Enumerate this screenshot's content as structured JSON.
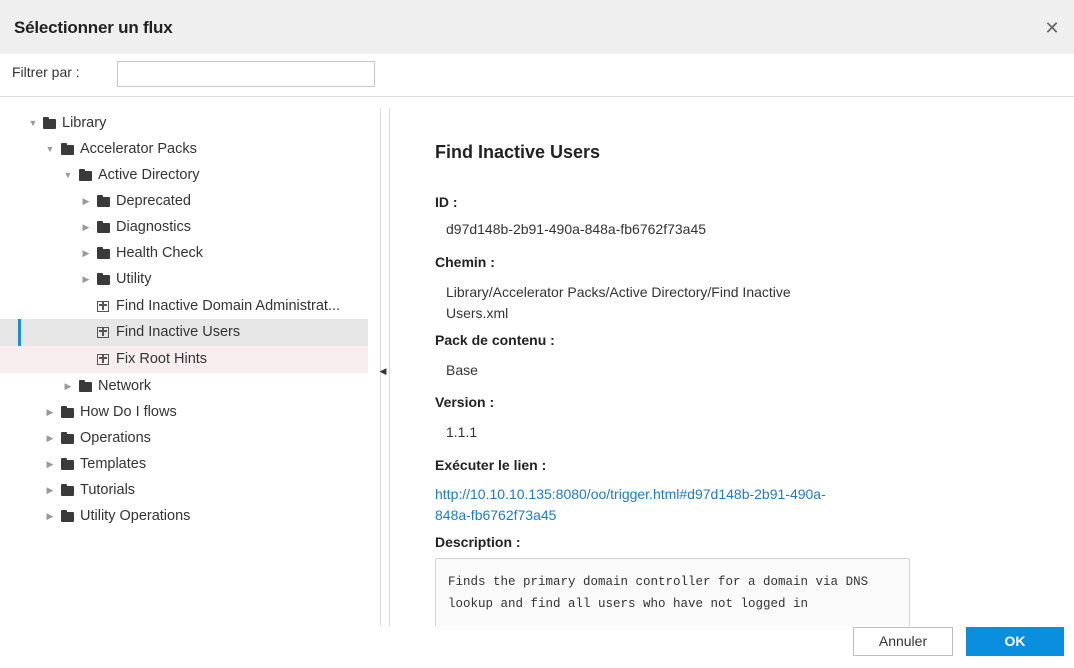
{
  "dialog": {
    "title": "Sélectionner un flux",
    "close_icon": "close-icon"
  },
  "filter": {
    "label": "Filtrer par :",
    "value": ""
  },
  "tree": {
    "nodes": [
      {
        "label": "Library",
        "type": "folder",
        "expanded": true
      },
      {
        "label": "Accelerator Packs",
        "type": "folder",
        "expanded": true
      },
      {
        "label": "Active Directory",
        "type": "folder",
        "expanded": true
      },
      {
        "label": "Deprecated",
        "type": "folder",
        "expanded": false
      },
      {
        "label": "Diagnostics",
        "type": "folder",
        "expanded": false
      },
      {
        "label": "Health Check",
        "type": "folder",
        "expanded": false
      },
      {
        "label": "Utility",
        "type": "folder",
        "expanded": false
      },
      {
        "label": "Find Inactive Domain Administrat...",
        "type": "flow"
      },
      {
        "label": "Find Inactive Users",
        "type": "flow",
        "selected": true
      },
      {
        "label": "Fix Root Hints",
        "type": "flow"
      },
      {
        "label": "Network",
        "type": "folder",
        "expanded": false
      },
      {
        "label": "How Do I flows",
        "type": "folder",
        "expanded": false
      },
      {
        "label": "Operations",
        "type": "folder",
        "expanded": false
      },
      {
        "label": "Templates",
        "type": "folder",
        "expanded": false
      },
      {
        "label": "Tutorials",
        "type": "folder",
        "expanded": false
      },
      {
        "label": "Utility Operations",
        "type": "folder",
        "expanded": false
      }
    ]
  },
  "details": {
    "title": "Find Inactive Users",
    "id_label": "ID :",
    "id_value": "d97d148b-2b91-490a-848a-fb6762f73a45",
    "path_label": "Chemin :",
    "path_value": "Library/Accelerator Packs/Active Directory/Find Inactive Users.xml",
    "pack_label": "Pack de contenu :",
    "pack_value": "Base",
    "version_label": "Version :",
    "version_value": "1.1.1",
    "run_link_label": "Exécuter le lien :",
    "run_link_value": "http://10.10.10.135:8080/oo/trigger.html#d97d148b-2b91-490a-848a-fb6762f73a45",
    "description_label": "Description :",
    "description_value": "Finds the primary domain controller for a domain via DNS lookup and find all users who have not logged in"
  },
  "buttons": {
    "cancel": "Annuler",
    "ok": "OK"
  },
  "colors": {
    "accent": "#0a8fde",
    "link": "#1a7cc9",
    "selection_bar": "#1c8fd7"
  }
}
